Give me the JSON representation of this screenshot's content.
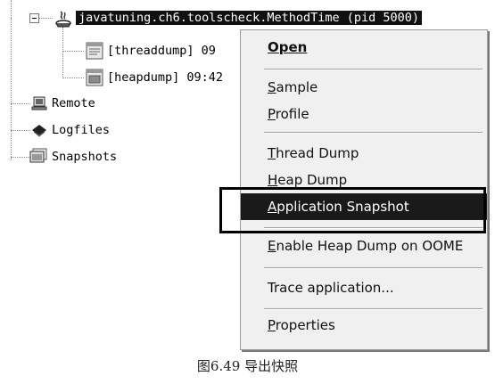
{
  "tree": {
    "process_label": "javatuning.ch6.toolscheck.MethodTime (pid 5000)",
    "children": [
      {
        "label": "[threaddump] 09",
        "icon": "threaddump-icon"
      },
      {
        "label": "[heapdump] 09:42",
        "icon": "heapdump-icon"
      }
    ],
    "roots": [
      {
        "label": "Remote",
        "icon": "remote-host-icon"
      },
      {
        "label": "Logfiles",
        "icon": "logfiles-icon"
      },
      {
        "label": "Snapshots",
        "icon": "snapshots-icon"
      }
    ]
  },
  "context_menu": {
    "items": [
      {
        "label": "Open",
        "mnemonic": "O",
        "bold": true
      },
      {
        "label": "Sample",
        "mnemonic": "S"
      },
      {
        "label": "Profile",
        "mnemonic": "P"
      },
      {
        "label": "Thread Dump",
        "mnemonic": "T"
      },
      {
        "label": "Heap Dump",
        "mnemonic": "H"
      },
      {
        "label": "Application Snapshot",
        "mnemonic": "A",
        "highlighted": true
      },
      {
        "label": "Enable Heap Dump on OOME",
        "mnemonic": "E"
      },
      {
        "label": "Trace application...",
        "mnemonic": ""
      },
      {
        "label": "Properties",
        "mnemonic": "P"
      }
    ]
  },
  "caption": "图6.49    导出快照",
  "colors": {
    "selection": "#111111",
    "menu_background": "#f0f0f0",
    "highlight": "#1a1a1a"
  }
}
